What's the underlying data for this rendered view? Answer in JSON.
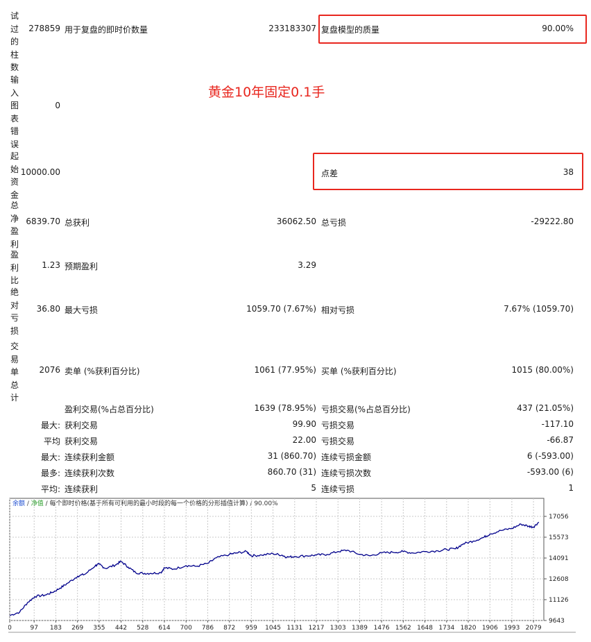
{
  "rows": {
    "bars_tested": {
      "label": "试过的柱数",
      "value": "278859"
    },
    "ticks_modelled": {
      "label": "用于复盘的即时价数量",
      "value": "233183307"
    },
    "modelling_quality": {
      "label": "复盘模型的质量",
      "value": "90.00%"
    },
    "mismatched_errors": {
      "label": "输入图表错误",
      "value": "0"
    },
    "initial_deposit": {
      "label": "起始资金",
      "value": "10000.00"
    },
    "spread": {
      "label": "点差",
      "value": "38"
    },
    "total_net_profit": {
      "label": "总净盈利",
      "value": "6839.70"
    },
    "gross_profit": {
      "label": "总获利",
      "value": "36062.50"
    },
    "gross_loss": {
      "label": "总亏损",
      "value": "-29222.80"
    },
    "profit_factor": {
      "label": "盈利比",
      "value": "1.23"
    },
    "expected_payoff": {
      "label": "预期盈利",
      "value": "3.29"
    },
    "absolute_drawdown": {
      "label": "绝对亏损",
      "value": "36.80"
    },
    "maximal_drawdown": {
      "label": "最大亏损",
      "value": "1059.70 (7.67%)"
    },
    "relative_drawdown": {
      "label": "相对亏损",
      "value": "7.67% (1059.70)"
    },
    "total_trades": {
      "label": "交易单总计",
      "value": "2076"
    },
    "short_positions": {
      "label": "卖单 (%获利百分比)",
      "value": "1061 (77.95%)"
    },
    "long_positions": {
      "label": "买单 (%获利百分比)",
      "value": "1015 (80.00%)"
    },
    "profit_trades": {
      "label": "盈利交易(%占总百分比)",
      "value": "1639 (78.95%)"
    },
    "loss_trades": {
      "label": "亏损交易(%占总百分比)",
      "value": "437 (21.05%)"
    },
    "largest_profit": {
      "prefix": "最大:",
      "label": "获利交易",
      "value": "99.90"
    },
    "largest_loss": {
      "label": "亏损交易",
      "value": "-117.10"
    },
    "average_profit": {
      "prefix": "平均",
      "label": "获利交易",
      "value": "22.00"
    },
    "average_loss": {
      "label": "亏损交易",
      "value": "-66.87"
    },
    "max_consec_wins_amount": {
      "prefix": "最大:",
      "label": "连续获利金额",
      "value": "31 (860.70)"
    },
    "max_consec_losses_amount": {
      "label": "连续亏损金额",
      "value": "6 (-593.00)"
    },
    "max_consec_profit_count": {
      "prefix": "最多:",
      "label": "连续获利次数",
      "value": "860.70 (31)"
    },
    "max_consec_loss_count": {
      "label": "连续亏损次数",
      "value": "-593.00 (6)"
    },
    "avg_consec_wins": {
      "prefix": "平均:",
      "label": "连续获利",
      "value": "5"
    },
    "avg_consec_losses": {
      "label": "连续亏损",
      "value": "1"
    }
  },
  "annotation": "黄金10年固定0.1手",
  "colors": {
    "highlight": "#e8261e",
    "balance_line": "#00008b",
    "legend_green": "#2a9d2a",
    "legend_blue": "#1f4fd1"
  },
  "chart_data": {
    "type": "line",
    "legend": {
      "balance": "余额",
      "separator": "/",
      "equity": "净值",
      "description": "/ 每个即时价格(基于所有可利用的最小时段的每一个价格的分形插值计算) / 90.00%"
    },
    "x_ticks": [
      "0",
      "97",
      "183",
      "269",
      "355",
      "442",
      "528",
      "614",
      "700",
      "786",
      "872",
      "959",
      "1045",
      "1131",
      "1217",
      "1303",
      "1389",
      "1476",
      "1562",
      "1648",
      "1734",
      "1820",
      "1906",
      "1993",
      "2079"
    ],
    "y_ticks": [
      "17056",
      "15573",
      "14091",
      "12608",
      "11126",
      "9643"
    ],
    "xlim": [
      0,
      2120
    ],
    "ylim": [
      9643,
      17056
    ],
    "grid": true,
    "series": [
      {
        "values": [
          [
            0,
            10000
          ],
          [
            40,
            10250
          ],
          [
            70,
            10900
          ],
          [
            100,
            11350
          ],
          [
            140,
            11450
          ],
          [
            170,
            11650
          ],
          [
            200,
            11950
          ],
          [
            230,
            12300
          ],
          [
            270,
            12800
          ],
          [
            300,
            12950
          ],
          [
            340,
            13550
          ],
          [
            355,
            13650
          ],
          [
            380,
            13350
          ],
          [
            420,
            13600
          ],
          [
            442,
            13850
          ],
          [
            470,
            13450
          ],
          [
            500,
            13050
          ],
          [
            528,
            13000
          ],
          [
            560,
            13000
          ],
          [
            600,
            13050
          ],
          [
            614,
            13400
          ],
          [
            650,
            13300
          ],
          [
            700,
            13550
          ],
          [
            740,
            13500
          ],
          [
            786,
            13700
          ],
          [
            820,
            14100
          ],
          [
            872,
            14350
          ],
          [
            900,
            14450
          ],
          [
            940,
            14550
          ],
          [
            959,
            14250
          ],
          [
            1000,
            14300
          ],
          [
            1045,
            14400
          ],
          [
            1080,
            14300
          ],
          [
            1100,
            14150
          ],
          [
            1131,
            14200
          ],
          [
            1180,
            14250
          ],
          [
            1217,
            14300
          ],
          [
            1260,
            14350
          ],
          [
            1303,
            14550
          ],
          [
            1340,
            14650
          ],
          [
            1389,
            14350
          ],
          [
            1430,
            14250
          ],
          [
            1476,
            14450
          ],
          [
            1520,
            14500
          ],
          [
            1562,
            14550
          ],
          [
            1600,
            14450
          ],
          [
            1648,
            14550
          ],
          [
            1700,
            14600
          ],
          [
            1734,
            14700
          ],
          [
            1770,
            14750
          ],
          [
            1800,
            15100
          ],
          [
            1840,
            15300
          ],
          [
            1880,
            15550
          ],
          [
            1906,
            15800
          ],
          [
            1950,
            16050
          ],
          [
            1993,
            16200
          ],
          [
            2030,
            16500
          ],
          [
            2060,
            16350
          ],
          [
            2079,
            16300
          ],
          [
            2100,
            16650
          ]
        ]
      }
    ]
  }
}
